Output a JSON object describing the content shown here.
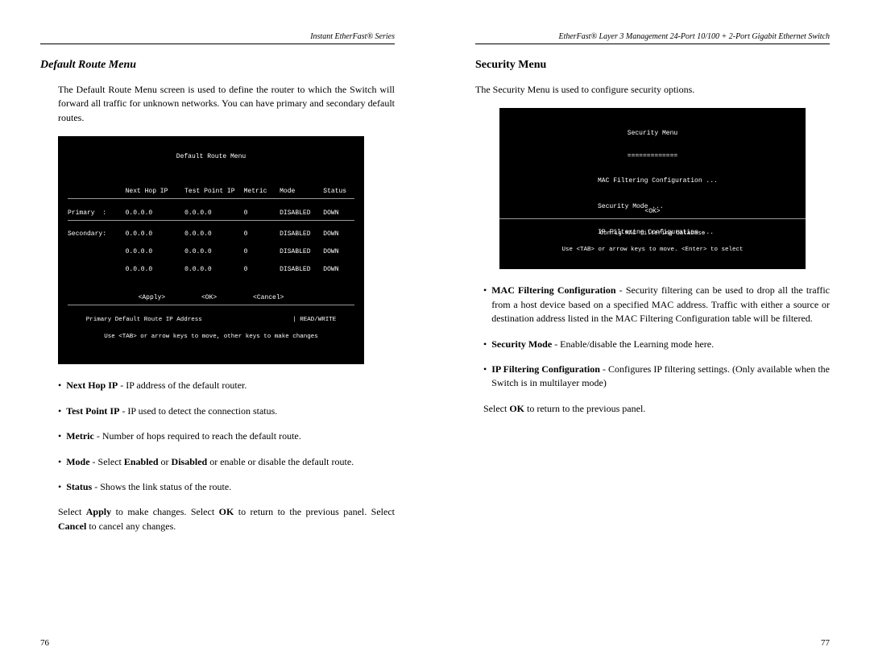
{
  "left": {
    "header": "Instant EtherFast® Series",
    "title": "Default Route Menu",
    "intro": "The Default Route Menu screen is used to define the router to which the Switch will forward all traffic for unknown networks. You can have primary and secondary default routes.",
    "term": {
      "title": "Default Route Menu",
      "cols": {
        "c1": "",
        "c2": "Next Hop IP",
        "c3": "Test Point IP",
        "c4": "Metric",
        "c5": "Mode",
        "c6": "Status"
      },
      "rows": [
        {
          "label": "Primary  :",
          "hop": "0.0.0.0",
          "tp": "0.0.0.0",
          "metric": "0",
          "mode": "DISABLED",
          "status": "DOWN"
        },
        {
          "label": "Secondary:",
          "hop": "0.0.0.0",
          "tp": "0.0.0.0",
          "metric": "0",
          "mode": "DISABLED",
          "status": "DOWN"
        },
        {
          "label": "",
          "hop": "0.0.0.0",
          "tp": "0.0.0.0",
          "metric": "0",
          "mode": "DISABLED",
          "status": "DOWN"
        },
        {
          "label": "",
          "hop": "0.0.0.0",
          "tp": "0.0.0.0",
          "metric": "0",
          "mode": "DISABLED",
          "status": "DOWN"
        }
      ],
      "btns": {
        "apply": "<Apply>",
        "ok": "<OK>",
        "cancel": "<Cancel>"
      },
      "hint1": "Primary Default Route IP Address",
      "hint2": "| READ/WRITE",
      "hint3": "Use <TAB> or arrow keys to move, other keys to make changes"
    },
    "bullets": [
      {
        "head": "Next Hop IP",
        "tail": " - IP address of the default router."
      },
      {
        "head": "Test Point IP",
        "tail": " - IP used to detect the connection status."
      },
      {
        "head": "Metric",
        "tail": " - Number of hops required to reach the default route."
      },
      {
        "head": "Mode",
        "tail_a": " - Select ",
        "tail_b": "Enabled",
        "tail_c": " or ",
        "tail_d": "Disabled",
        "tail_e": " or enable or disable the default route."
      },
      {
        "head": "Status",
        "tail": " - Shows the link status of the route."
      }
    ],
    "closing_a": "Select ",
    "closing_b": "Apply",
    "closing_c": " to make changes. Select ",
    "closing_d": "OK",
    "closing_e": " to return to the previous panel. Select ",
    "closing_f": "Cancel",
    "closing_g": " to cancel any changes.",
    "pageno": "76"
  },
  "right": {
    "header": "EtherFast® Layer 3 Management 24-Port 10/100 + 2-Port Gigabit Ethernet Switch",
    "title": "Security Menu",
    "intro": "The Security Menu is used to configure security options.",
    "term": {
      "title": "Security Menu",
      "underline": "=============",
      "items": [
        "MAC Filtering Configuration ...",
        "Security Mode ...",
        "IP Filtering Configuration ..."
      ],
      "ok": "<OK>",
      "hint1": "Config MAC filtering database",
      "hint2": "Use <TAB> or arrow keys to move. <Enter> to select"
    },
    "bullets": [
      {
        "head": "MAC Filtering Configuration",
        "tail": " - Security filtering can be used to drop all the traffic from a host device based on a specified MAC address. Traffic with either a source or destination address listed in the MAC Filtering Configuration table will be filtered."
      },
      {
        "head": "Security Mode",
        "tail": " - Enable/disable the Learning mode here."
      },
      {
        "head": "IP Filtering Configuration",
        "tail": " - Configures IP filtering settings. (Only available when the Switch is in multilayer mode)"
      }
    ],
    "closing_a": "Select ",
    "closing_b": "OK",
    "closing_c": " to return to the previous panel.",
    "pageno": "77"
  }
}
